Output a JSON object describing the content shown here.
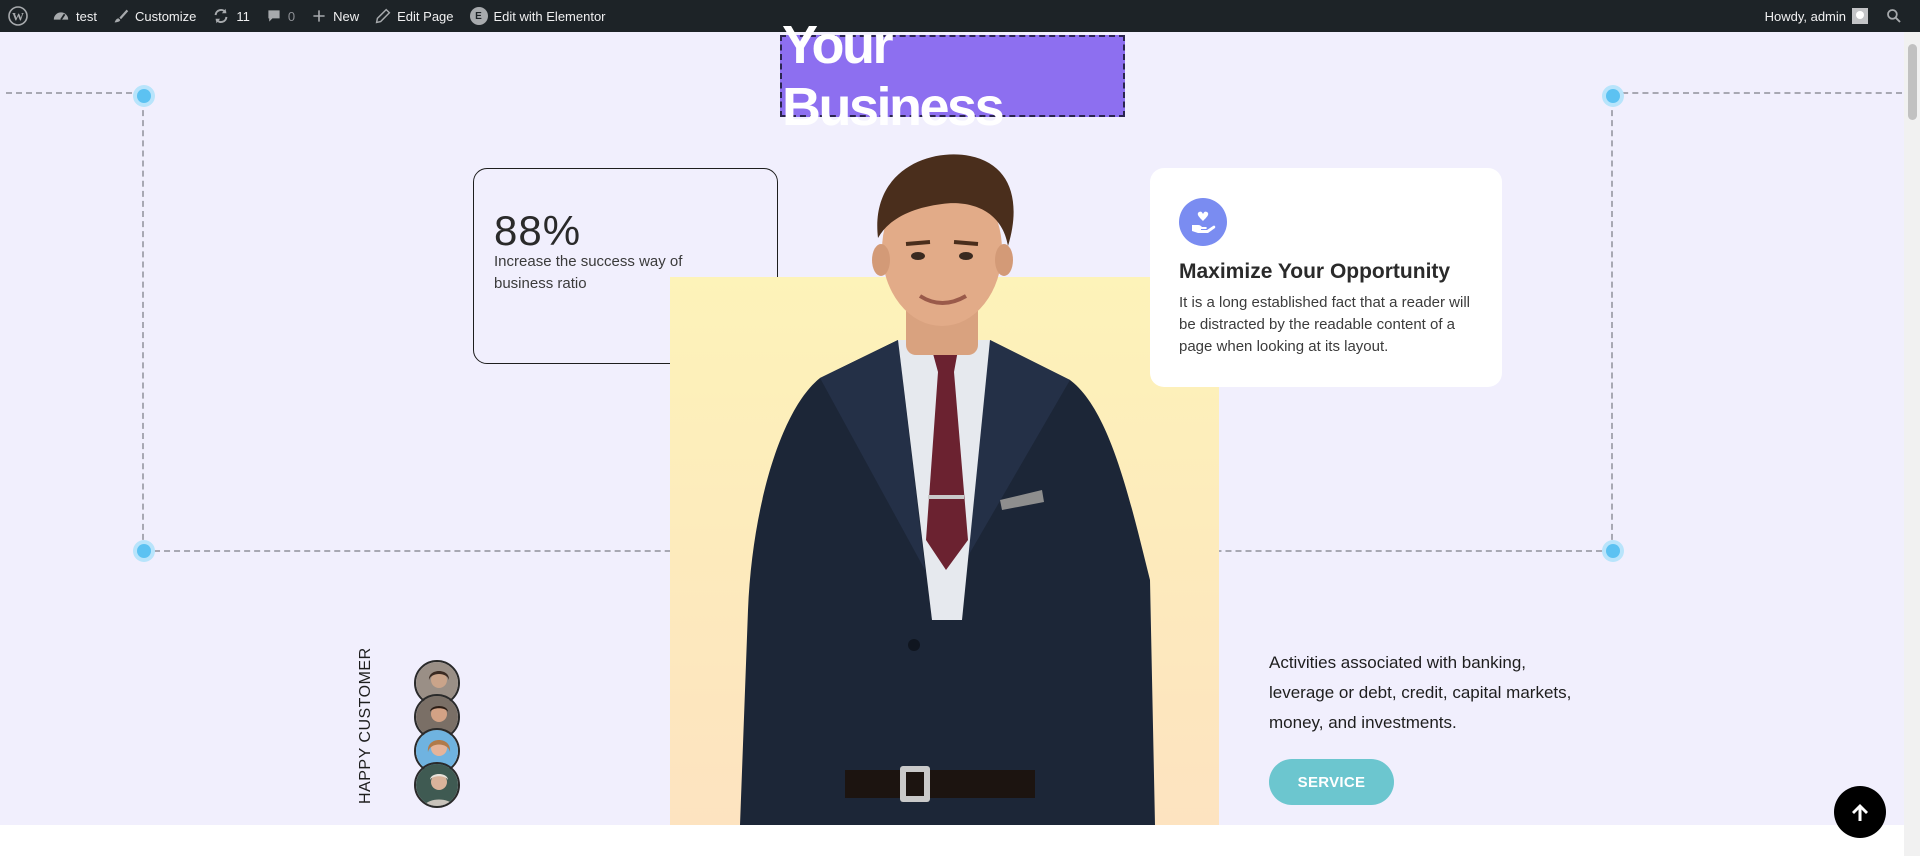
{
  "adminbar": {
    "site_name": "test",
    "customize": "Customize",
    "updates_count": "11",
    "comments_count": "0",
    "new_label": "New",
    "edit_page": "Edit Page",
    "edit_elementor": "Edit with Elementor",
    "elementor_badge": "E",
    "howdy": "Howdy, admin"
  },
  "hero": {
    "headline": "Your Business"
  },
  "stat_card": {
    "value": "88%",
    "description": "Increase the success way of business ratio"
  },
  "feature_card": {
    "icon": "heart-hand-icon",
    "title": "Maximize Your Opportunity",
    "text": "It is a long established fact that a reader will be distracted by the readable content of a page when looking at its layout."
  },
  "customers": {
    "label": "HAPPY CUSTOMER"
  },
  "service": {
    "text": "Activities associated with banking, leverage or debt, credit, capital markets, money, and investments.",
    "button": "SERVICE"
  },
  "colors": {
    "admin_bar": "#1d2327",
    "page_bg": "#f1effd",
    "headline_bg": "#8d6ff0",
    "feature_icon_bg": "#7a8cf1",
    "service_button": "#6cc6cf",
    "handle": "#5cc2f2"
  }
}
